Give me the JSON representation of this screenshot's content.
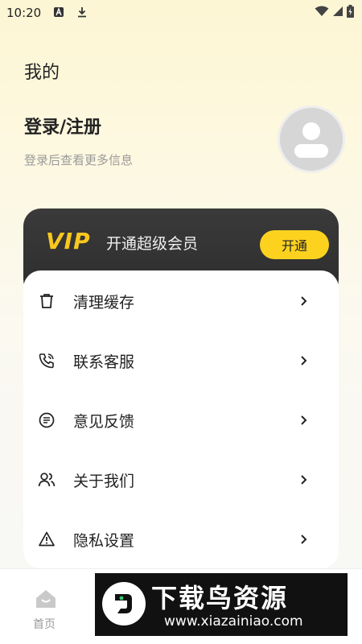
{
  "status_bar": {
    "time": "10:20"
  },
  "header": {
    "title": "我的"
  },
  "profile": {
    "login_title": "登录/注册",
    "login_subtitle": "登录后查看更多信息"
  },
  "vip": {
    "logo": "VIP",
    "text": "开通超级会员",
    "button_label": "开通",
    "accent_color": "#fcd21f"
  },
  "menu": {
    "items": [
      {
        "label": "清理缓存",
        "icon": "trash-icon"
      },
      {
        "label": "联系客服",
        "icon": "phone-icon"
      },
      {
        "label": "意见反馈",
        "icon": "feedback-icon"
      },
      {
        "label": "关于我们",
        "icon": "users-icon"
      },
      {
        "label": "隐私设置",
        "icon": "warning-icon"
      }
    ]
  },
  "bottom_nav": {
    "home_label": "首页"
  },
  "watermark": {
    "title": "下载鸟资源",
    "url": "www.xiazainiao.com"
  }
}
